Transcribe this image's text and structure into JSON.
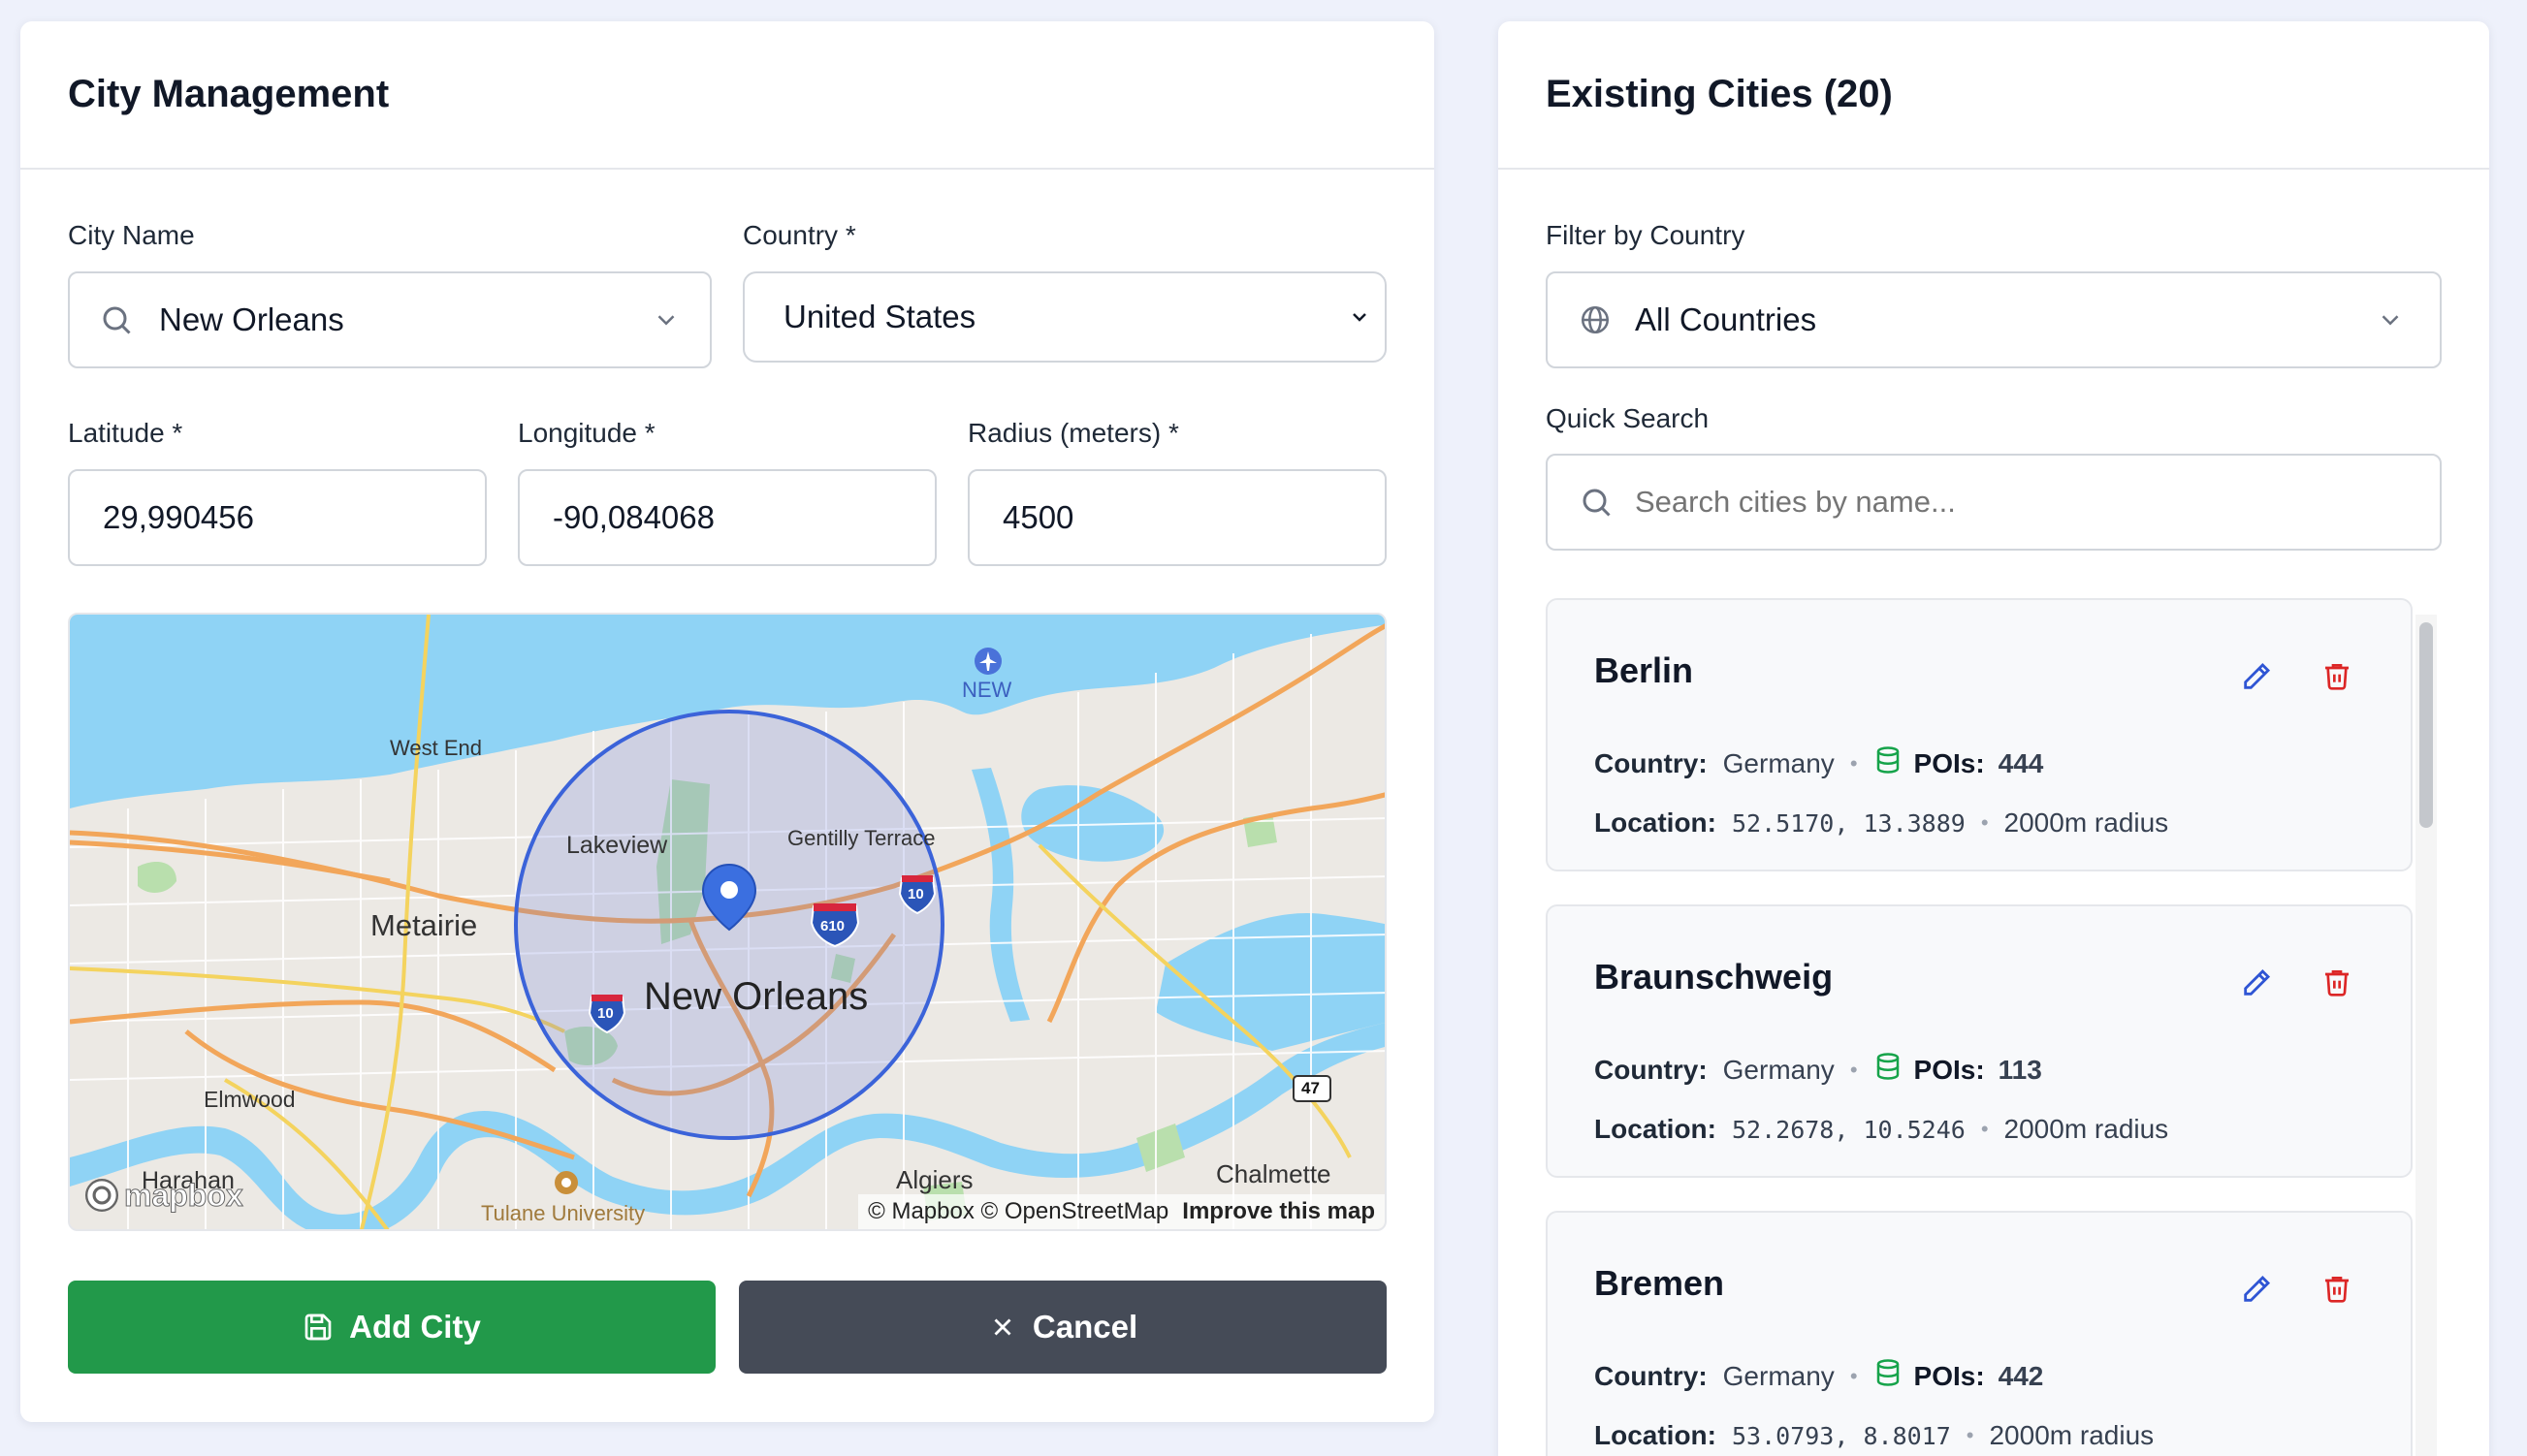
{
  "left": {
    "title": "City Management",
    "city_name": {
      "label": "City Name",
      "value": "New Orleans"
    },
    "country": {
      "label": "Country *",
      "value": "United States"
    },
    "latitude": {
      "label": "Latitude *",
      "value": "29,990456"
    },
    "longitude": {
      "label": "Longitude *",
      "value": "-90,084068"
    },
    "radius": {
      "label": "Radius (meters) *",
      "value": "4500"
    },
    "map": {
      "labels": {
        "new_orleans": "New Orleans",
        "metairie": "Metairie",
        "lakeview": "Lakeview",
        "gentilly": "Gentilly Terrace",
        "west_end": "West End",
        "elmwood": "Elmwood",
        "harahan": "Harahan",
        "algiers": "Algiers",
        "chalmette": "Chalmette",
        "tulane": "Tulane University",
        "airport": "NEW",
        "i610": "610",
        "i10a": "10",
        "i10b": "10",
        "r47": "47"
      },
      "logo": "mapbox",
      "attribution": "© Mapbox © OpenStreetMap",
      "improve": "Improve this map"
    },
    "add_button": "Add City",
    "cancel_button": "Cancel",
    "colors": {
      "add": "#22994a",
      "cancel": "#454b57",
      "radius_circle": "#3b63d9"
    }
  },
  "right": {
    "title": "Existing Cities (20)",
    "filter": {
      "label": "Filter by Country",
      "value": "All Countries"
    },
    "search": {
      "label": "Quick Search",
      "placeholder": "Search cities by name..."
    },
    "labels": {
      "country": "Country:",
      "pois": "POIs:",
      "location": "Location:"
    },
    "cities": [
      {
        "name": "Berlin",
        "country": "Germany",
        "pois": "444",
        "location": "52.5170, 13.3889",
        "radius": "2000m radius"
      },
      {
        "name": "Braunschweig",
        "country": "Germany",
        "pois": "113",
        "location": "52.2678, 10.5246",
        "radius": "2000m radius"
      },
      {
        "name": "Bremen",
        "country": "Germany",
        "pois": "442",
        "location": "53.0793, 8.8017",
        "radius": "2000m radius"
      }
    ]
  }
}
